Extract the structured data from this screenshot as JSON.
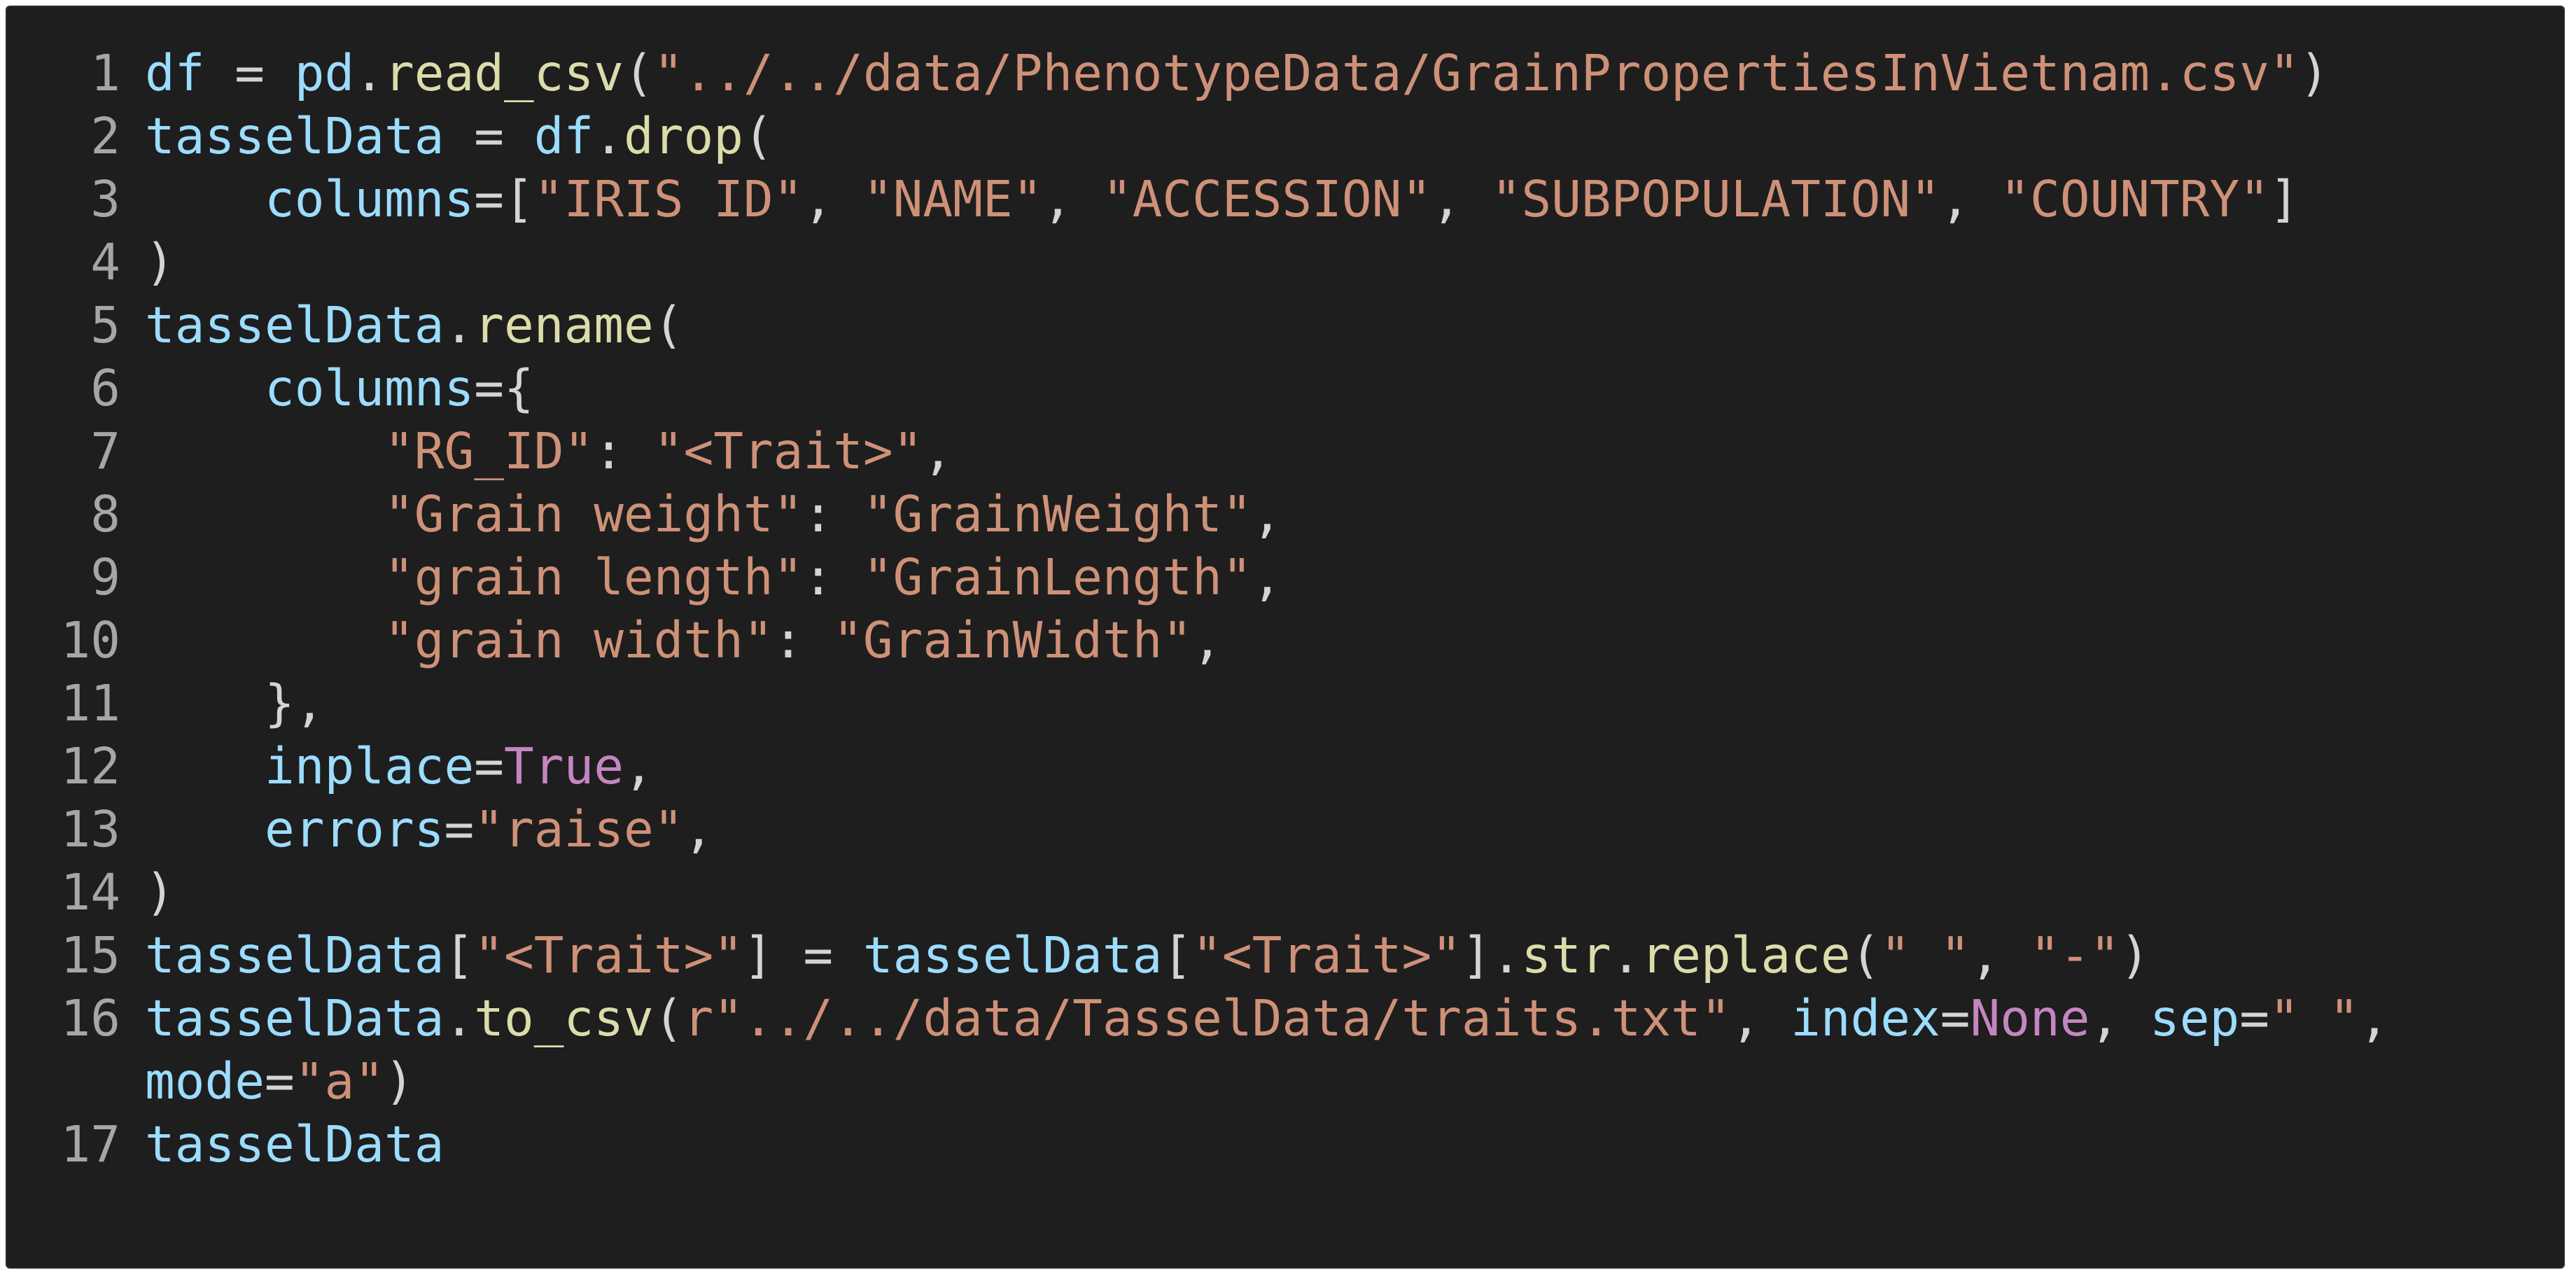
{
  "editor": {
    "theme_colors": {
      "background": "#1e1e1e",
      "default_text": "#d4d4d4",
      "variable": "#9cdcfe",
      "function": "#dcdcaa",
      "string": "#ce9178",
      "keyword": "#c586c0",
      "line_number": "#a6a6a6"
    },
    "lines": [
      {
        "number": "1",
        "tokens": [
          {
            "t": "df",
            "k": "var"
          },
          {
            "t": " = ",
            "k": "op"
          },
          {
            "t": "pd",
            "k": "var"
          },
          {
            "t": ".",
            "k": "op"
          },
          {
            "t": "read_csv",
            "k": "func"
          },
          {
            "t": "(",
            "k": "op"
          },
          {
            "t": "\"../../data/PhenotypeData/GrainPropertiesInVietnam.csv\"",
            "k": "str"
          },
          {
            "t": ")",
            "k": "op"
          }
        ]
      },
      {
        "number": "2",
        "tokens": [
          {
            "t": "tasselData",
            "k": "var"
          },
          {
            "t": " = ",
            "k": "op"
          },
          {
            "t": "df",
            "k": "var"
          },
          {
            "t": ".",
            "k": "op"
          },
          {
            "t": "drop",
            "k": "func"
          },
          {
            "t": "(",
            "k": "op"
          }
        ]
      },
      {
        "number": "3",
        "tokens": [
          {
            "t": "    ",
            "k": "op"
          },
          {
            "t": "columns",
            "k": "var"
          },
          {
            "t": "=[",
            "k": "op"
          },
          {
            "t": "\"IRIS ID\"",
            "k": "str"
          },
          {
            "t": ", ",
            "k": "op"
          },
          {
            "t": "\"NAME\"",
            "k": "str"
          },
          {
            "t": ", ",
            "k": "op"
          },
          {
            "t": "\"ACCESSION\"",
            "k": "str"
          },
          {
            "t": ", ",
            "k": "op"
          },
          {
            "t": "\"SUBPOPULATION\"",
            "k": "str"
          },
          {
            "t": ", ",
            "k": "op"
          },
          {
            "t": "\"COUNTRY\"",
            "k": "str"
          },
          {
            "t": "]",
            "k": "op"
          }
        ]
      },
      {
        "number": "4",
        "tokens": [
          {
            "t": ")",
            "k": "op"
          }
        ]
      },
      {
        "number": "5",
        "tokens": [
          {
            "t": "tasselData",
            "k": "var"
          },
          {
            "t": ".",
            "k": "op"
          },
          {
            "t": "rename",
            "k": "func"
          },
          {
            "t": "(",
            "k": "op"
          }
        ]
      },
      {
        "number": "6",
        "tokens": [
          {
            "t": "    ",
            "k": "op"
          },
          {
            "t": "columns",
            "k": "var"
          },
          {
            "t": "={",
            "k": "op"
          }
        ]
      },
      {
        "number": "7",
        "tokens": [
          {
            "t": "        ",
            "k": "op"
          },
          {
            "t": "\"RG_ID\"",
            "k": "str"
          },
          {
            "t": ": ",
            "k": "op"
          },
          {
            "t": "\"<Trait>\"",
            "k": "str"
          },
          {
            "t": ",",
            "k": "op"
          }
        ]
      },
      {
        "number": "8",
        "tokens": [
          {
            "t": "        ",
            "k": "op"
          },
          {
            "t": "\"Grain weight\"",
            "k": "str"
          },
          {
            "t": ": ",
            "k": "op"
          },
          {
            "t": "\"GrainWeight\"",
            "k": "str"
          },
          {
            "t": ",",
            "k": "op"
          }
        ]
      },
      {
        "number": "9",
        "tokens": [
          {
            "t": "        ",
            "k": "op"
          },
          {
            "t": "\"grain length\"",
            "k": "str"
          },
          {
            "t": ": ",
            "k": "op"
          },
          {
            "t": "\"GrainLength\"",
            "k": "str"
          },
          {
            "t": ",",
            "k": "op"
          }
        ]
      },
      {
        "number": "10",
        "tokens": [
          {
            "t": "        ",
            "k": "op"
          },
          {
            "t": "\"grain width\"",
            "k": "str"
          },
          {
            "t": ": ",
            "k": "op"
          },
          {
            "t": "\"GrainWidth\"",
            "k": "str"
          },
          {
            "t": ",",
            "k": "op"
          }
        ]
      },
      {
        "number": "11",
        "tokens": [
          {
            "t": "    },",
            "k": "op"
          }
        ]
      },
      {
        "number": "12",
        "tokens": [
          {
            "t": "    ",
            "k": "op"
          },
          {
            "t": "inplace",
            "k": "var"
          },
          {
            "t": "=",
            "k": "op"
          },
          {
            "t": "True",
            "k": "kw"
          },
          {
            "t": ",",
            "k": "op"
          }
        ]
      },
      {
        "number": "13",
        "tokens": [
          {
            "t": "    ",
            "k": "op"
          },
          {
            "t": "errors",
            "k": "var"
          },
          {
            "t": "=",
            "k": "op"
          },
          {
            "t": "\"raise\"",
            "k": "str"
          },
          {
            "t": ",",
            "k": "op"
          }
        ]
      },
      {
        "number": "14",
        "tokens": [
          {
            "t": ")",
            "k": "op"
          }
        ]
      },
      {
        "number": "15",
        "tokens": [
          {
            "t": "tasselData",
            "k": "var"
          },
          {
            "t": "[",
            "k": "op"
          },
          {
            "t": "\"<Trait>\"",
            "k": "str"
          },
          {
            "t": "] = ",
            "k": "op"
          },
          {
            "t": "tasselData",
            "k": "var"
          },
          {
            "t": "[",
            "k": "op"
          },
          {
            "t": "\"<Trait>\"",
            "k": "str"
          },
          {
            "t": "].",
            "k": "op"
          },
          {
            "t": "str",
            "k": "func"
          },
          {
            "t": ".",
            "k": "op"
          },
          {
            "t": "replace",
            "k": "func"
          },
          {
            "t": "(",
            "k": "op"
          },
          {
            "t": "\" \"",
            "k": "str"
          },
          {
            "t": ", ",
            "k": "op"
          },
          {
            "t": "\"-\"",
            "k": "str"
          },
          {
            "t": ")",
            "k": "op"
          }
        ]
      },
      {
        "number": "16",
        "tokens": [
          {
            "t": "tasselData",
            "k": "var"
          },
          {
            "t": ".",
            "k": "op"
          },
          {
            "t": "to_csv",
            "k": "func"
          },
          {
            "t": "(",
            "k": "op"
          },
          {
            "t": "r\"../../data/TasselData/traits.txt\"",
            "k": "str"
          },
          {
            "t": ", ",
            "k": "op"
          },
          {
            "t": "index",
            "k": "var"
          },
          {
            "t": "=",
            "k": "op"
          },
          {
            "t": "None",
            "k": "kw"
          },
          {
            "t": ", ",
            "k": "op"
          },
          {
            "t": "sep",
            "k": "var"
          },
          {
            "t": "=",
            "k": "op"
          },
          {
            "t": "\" \"",
            "k": "str"
          },
          {
            "t": ", ",
            "k": "op"
          },
          {
            "t": "mode",
            "k": "var"
          },
          {
            "t": "=",
            "k": "op"
          },
          {
            "t": "\"a\"",
            "k": "str"
          },
          {
            "t": ")",
            "k": "op"
          }
        ]
      },
      {
        "number": "17",
        "tokens": [
          {
            "t": "tasselData",
            "k": "var"
          }
        ]
      }
    ]
  }
}
